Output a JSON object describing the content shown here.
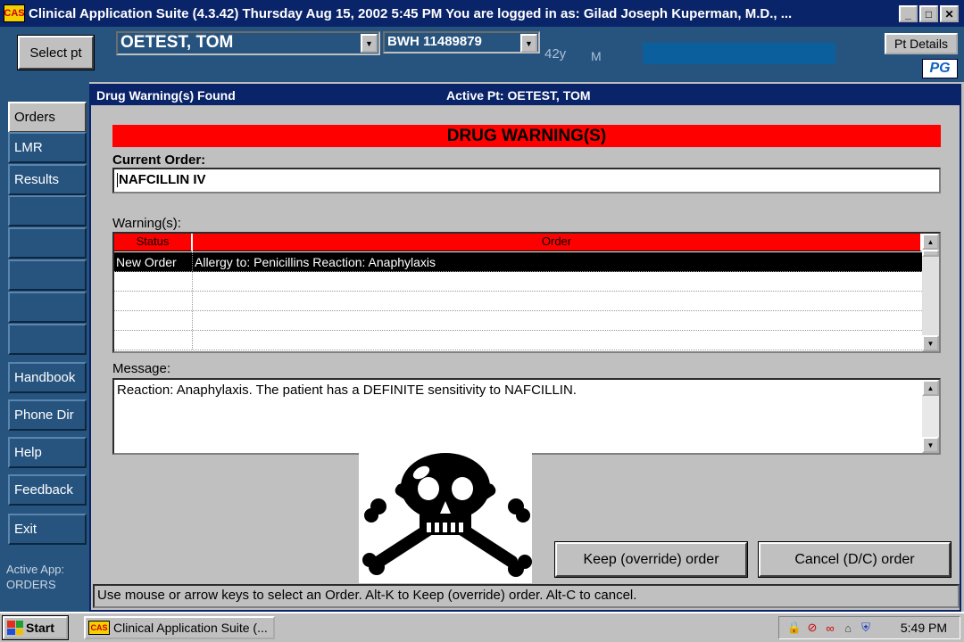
{
  "window": {
    "title": "Clinical Application Suite  (4.3.42)  Thursday  Aug 15, 2002 5:45 PM  You are logged in as:  Gilad Joseph Kuperman, M.D., ...",
    "app_icon": "CAS",
    "min_glyph": "_",
    "max_glyph": "□",
    "close_glyph": "✕"
  },
  "header": {
    "select_pt_label": "Select pt",
    "patient_name": "OETEST, TOM",
    "mrn": "BWH    11489879",
    "age": "42y",
    "sex": "M",
    "pt_details_label": "Pt Details",
    "logo_text": "PG"
  },
  "nav": {
    "items": [
      {
        "label": "Orders"
      },
      {
        "label": "LMR"
      },
      {
        "label": "Results"
      },
      {
        "label": ""
      },
      {
        "label": ""
      },
      {
        "label": ""
      },
      {
        "label": ""
      },
      {
        "label": ""
      },
      {
        "label": "Handbook"
      },
      {
        "label": "Phone Dir"
      },
      {
        "label": "Help"
      },
      {
        "label": "Feedback"
      },
      {
        "label": "Exit"
      }
    ],
    "active_app_label": "Active App:",
    "active_app_value": "ORDERS"
  },
  "dialog": {
    "title": "Drug Warning(s) Found",
    "active_pt": "Active Pt: OETEST, TOM",
    "banner": "DRUG WARNING(S)",
    "current_order_label": "Current Order:",
    "current_order_value": "NAFCILLIN     IV",
    "warnings_label": "Warning(s):",
    "columns": [
      "Status",
      "Order"
    ],
    "rows": [
      {
        "status": "New Order",
        "order": "Allergy to: Penicillins  Reaction: Anaphylaxis"
      },
      {
        "status": "",
        "order": ""
      },
      {
        "status": "",
        "order": ""
      },
      {
        "status": "",
        "order": ""
      },
      {
        "status": "",
        "order": ""
      }
    ],
    "message_label": "Message:",
    "message_text": "Reaction: Anaphylaxis.  The patient has a DEFINITE sensitivity to NAFCILLIN.",
    "keep_button": "Keep (override) order",
    "cancel_button": "Cancel (D/C) order",
    "status_text": "Use mouse or arrow keys to select an Order.  Alt-K to Keep (override) order.  Alt-C to cancel."
  },
  "taskbar": {
    "start_label": "Start",
    "task_label": "Clinical Application Suite  (...",
    "clock": "5:49 PM",
    "tray_icons": [
      "lock-icon",
      "no-entry-icon",
      "link-icon",
      "network-icon",
      "shield-icon"
    ]
  },
  "colors": {
    "title_blue": "#0a246a",
    "app_blue": "#27547f",
    "warning_red": "#ff0000",
    "face": "#c0c0c0"
  }
}
